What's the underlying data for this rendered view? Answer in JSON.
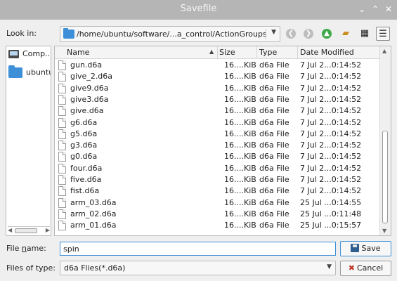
{
  "window": {
    "title": "Savefile",
    "minimize_glyph": "⌄",
    "maximize_glyph": "⌃",
    "close_glyph": "✕"
  },
  "lookin": {
    "label": "Look in:",
    "path": "/home/ubuntu/software/...a_control/ActionGroups"
  },
  "toolbar": {
    "icons": [
      "back-icon",
      "forward-icon",
      "parent-directory-icon",
      "new-folder-icon",
      "list-view-icon",
      "detail-view-icon"
    ]
  },
  "sidebar": {
    "items": [
      {
        "label": "Comp..."
      },
      {
        "label": "ubuntu"
      }
    ]
  },
  "filelist": {
    "headers": {
      "name": "Name",
      "size": "Size",
      "type": "Type",
      "date": "Date Modified"
    },
    "rows": [
      {
        "name": "gun.d6a",
        "size": "16....KiB",
        "type": "d6a File",
        "date": "7 Jul 2...0:14:52"
      },
      {
        "name": "give_2.d6a",
        "size": "16....KiB",
        "type": "d6a File",
        "date": "7 Jul 2...0:14:52"
      },
      {
        "name": "give9.d6a",
        "size": "16....KiB",
        "type": "d6a File",
        "date": "7 Jul 2...0:14:52"
      },
      {
        "name": "give3.d6a",
        "size": "16....KiB",
        "type": "d6a File",
        "date": "7 Jul 2...0:14:52"
      },
      {
        "name": "give.d6a",
        "size": "16....KiB",
        "type": "d6a File",
        "date": "7 Jul 2...0:14:52"
      },
      {
        "name": "g6.d6a",
        "size": "16....KiB",
        "type": "d6a File",
        "date": "7 Jul 2...0:14:52"
      },
      {
        "name": "g5.d6a",
        "size": "16....KiB",
        "type": "d6a File",
        "date": "7 Jul 2...0:14:52"
      },
      {
        "name": "g3.d6a",
        "size": "16....KiB",
        "type": "d6a File",
        "date": "7 Jul 2...0:14:52"
      },
      {
        "name": "g0.d6a",
        "size": "16....KiB",
        "type": "d6a File",
        "date": "7 Jul 2...0:14:52"
      },
      {
        "name": "four.d6a",
        "size": "16....KiB",
        "type": "d6a File",
        "date": "7 Jul 2...0:14:52"
      },
      {
        "name": "five.d6a",
        "size": "16....KiB",
        "type": "d6a File",
        "date": "7 Jul 2...0:14:52"
      },
      {
        "name": "fist.d6a",
        "size": "16....KiB",
        "type": "d6a File",
        "date": "7 Jul 2...0:14:52"
      },
      {
        "name": "arm_03.d6a",
        "size": "16....KiB",
        "type": "d6a File",
        "date": "25 Jul ...0:14:55"
      },
      {
        "name": "arm_02.d6a",
        "size": "16....KiB",
        "type": "d6a File",
        "date": "25 Jul ...0:11:48"
      },
      {
        "name": "arm_01.d6a",
        "size": "16....KiB",
        "type": "d6a File",
        "date": "25 Jul ...0:15:57"
      }
    ]
  },
  "filename": {
    "label_prefix": "File ",
    "label_mnemonic": "n",
    "label_suffix": "ame:",
    "value": "spin"
  },
  "filetype": {
    "label": "Files of type:",
    "value": "d6a Flies(*.d6a)"
  },
  "buttons": {
    "save_label": "Save",
    "cancel_label": "Cancel"
  },
  "colors": {
    "accent": "#3d8fd8",
    "titlebar": "#b5b5b5",
    "background": "#efefef"
  }
}
